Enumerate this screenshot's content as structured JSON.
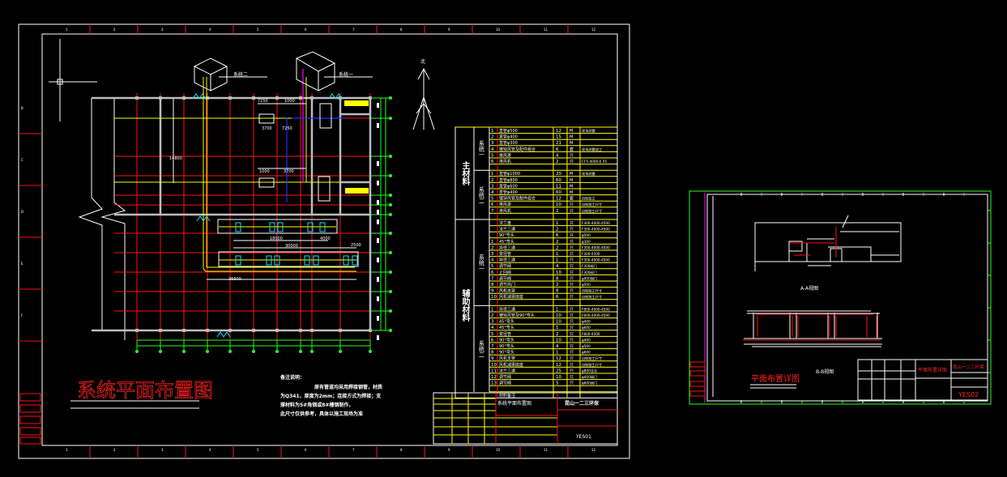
{
  "colors": {
    "background": "#000000",
    "frame": "#ffffff",
    "grid": "#ff1010",
    "pipe": "#ffff00",
    "dimension": "#20ff20",
    "equipment": "#00e5ff",
    "duct2": "#ff00ff",
    "duct3": "#2030ff",
    "wall": "#bdbdbd"
  },
  "sheet1": {
    "title": "系统平面布置图",
    "ruler_top": [
      "1",
      "2",
      "3",
      "4",
      "5",
      "6",
      "7",
      "8",
      "9",
      "10",
      "11",
      "12"
    ],
    "ruler_side": [
      "B",
      "C",
      "D",
      "E",
      "F"
    ],
    "systems": [
      "系统二",
      "系统一"
    ],
    "north_label": "北",
    "dimensions": [
      "7250",
      "1000",
      "3700",
      "7250",
      "1000",
      "3700",
      "18000",
      "4000",
      "30000",
      "2500",
      "36600",
      "14800"
    ],
    "notes": {
      "heading": "备注说明：",
      "lines": [
        "原有管道均采用焊接钢管，材质",
        "为Q341，厚度为2mm；连接方式为焊接；支",
        "撑材料为5#角钢或8#槽钢制作，",
        "此尺寸仅供参考，具体以施工现场为准"
      ]
    },
    "material_table": {
      "groups": [
        "主材料",
        "辅助材料"
      ],
      "subgroups": [
        "系统一",
        "系统二",
        "系统一",
        "系统二"
      ],
      "sections": [
        {
          "rows": [
            [
              "1",
              "直管φ500",
              "12",
              "M",
              "现场测量"
            ],
            [
              "2",
              "直管φ400",
              "15",
              "M",
              ""
            ],
            [
              "3",
              "直管φ300",
              "21",
              "M",
              ""
            ],
            [
              "4",
              "镀锌风管及配件组合",
              "6",
              "套",
              "现场测量加工"
            ],
            [
              "5",
              "排风罩",
              "4",
              "只",
              ""
            ],
            [
              "6",
              "排风机",
              "2",
              "只",
              "CF5-4000-0.55"
            ]
          ]
        },
        {
          "rows": [
            [
              "1",
              "直管φ1000",
              "20",
              "M",
              "现场测量"
            ],
            [
              "2",
              "直管φ800",
              "60",
              "M",
              ""
            ],
            [
              "3",
              "直管φ600",
              "11",
              "M",
              ""
            ],
            [
              "4",
              "直管φ400",
              "60",
              "M",
              ""
            ],
            [
              "5",
              "镀锌风管及配件组合",
              "12",
              "套",
              "自制加工"
            ],
            [
              "6",
              "排风罩",
              "10",
              "只",
              "自制加工尺寸"
            ],
            [
              "7",
              "排风机",
              "2",
              "只",
              "自制加工尺寸"
            ]
          ]
        },
        {
          "rows": [
            [
              "",
              "法兰盘",
              "1",
              "只",
              "F300-4000-4500"
            ],
            [
              "",
              "法兰三通",
              "2",
              "只",
              "F300-4000-4500"
            ],
            [
              "",
              "90°弯头",
              "6",
              "只",
              "φ500"
            ],
            [
              "1",
              "45°弯头",
              "2",
              "只",
              "φ300"
            ],
            [
              "2",
              "异径三通",
              "2",
              "只",
              "F300-4000-4500"
            ],
            [
              "3",
              "变径管",
              "1",
              "只",
              "F300-4500"
            ],
            [
              "4",
              "异径三通",
              "1",
              "只",
              "F300-4000-4500"
            ],
            [
              "5",
              "调节阀",
              "4",
              "只",
              "F300阀门"
            ],
            [
              "6",
              "止回阀",
              "10",
              "只",
              "F300阀门"
            ],
            [
              "7",
              "调节阀",
              "8",
              "只",
              "φ400阀门"
            ],
            [
              "8",
              "调节风门",
              "2",
              "只",
              "φ500"
            ],
            [
              "9",
              "风机支架",
              "8",
              "只",
              "自制加工尺寸"
            ],
            [
              "10",
              "风机减振底座",
              "6",
              "只",
              "自制加工尺寸"
            ]
          ]
        },
        {
          "rows": [
            [
              "1",
              "异径三通",
              "1",
              "只",
              "F800-4000-4500"
            ],
            [
              "2",
              "镀锌风管及90°弯头",
              "10",
              "只",
              "F800-4000-4500"
            ],
            [
              "3",
              "45°弯头",
              "10",
              "只",
              "φ400"
            ],
            [
              "4",
              "45°弯头",
              "1",
              "只",
              "φ600"
            ],
            [
              "5",
              "变径管",
              "2",
              "只",
              "F800-4500"
            ],
            [
              "6",
              "90°弯头",
              "10",
              "只",
              "φ400"
            ],
            [
              "7",
              "90°弯头",
              "4",
              "只",
              "φ500"
            ],
            [
              "8",
              "90°弯头",
              "1",
              "只",
              "φ600"
            ],
            [
              "9",
              "风机支架",
              "12",
              "只",
              "自制加工尺寸"
            ],
            [
              "10",
              "风机减振底座",
              "12",
              "只",
              "自制加工尺寸"
            ],
            [
              "11",
              "法兰三通",
              "25",
              "只",
              "φ800法兰"
            ],
            [
              "12",
              "调节阀",
              "10",
              "只",
              "φ400阀门"
            ],
            [
              "13",
              "调节阀",
              "5",
              "只",
              "φ600阀门"
            ]
          ]
        }
      ],
      "footer": "材料备注"
    },
    "title_block": {
      "drawing_name": "系统平面布置图",
      "company": "昆山一二三环保",
      "drawing_no": "YES01"
    }
  },
  "sheet2": {
    "view_a": "A-A视图",
    "view_b": "B-B视图",
    "title": "平面布置详图",
    "title_block": {
      "drawing_name": "平面布置详图",
      "company": "昆山一二三环保",
      "drawing_no": "YES02"
    }
  }
}
